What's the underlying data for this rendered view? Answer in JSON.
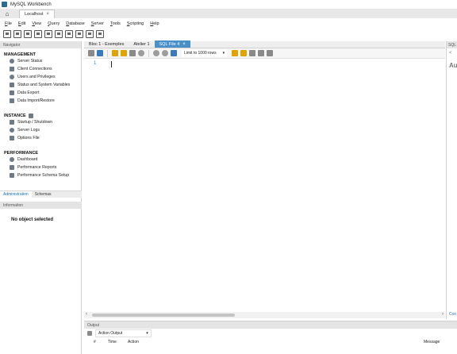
{
  "window": {
    "title": "MySQL Workbench"
  },
  "connection_tab": {
    "label": "Localhost",
    "close": "×"
  },
  "menu": [
    {
      "label": "File",
      "u": "F",
      "rest": "ile"
    },
    {
      "label": "Edit",
      "u": "E",
      "rest": "dit"
    },
    {
      "label": "View",
      "u": "V",
      "rest": "iew"
    },
    {
      "label": "Query",
      "u": "Q",
      "rest": "uery"
    },
    {
      "label": "Database",
      "u": "D",
      "rest": "atabase"
    },
    {
      "label": "Server",
      "u": "S",
      "rest": "erver"
    },
    {
      "label": "Tools",
      "u": "T",
      "rest": "ools"
    },
    {
      "label": "Scripting",
      "u": "S",
      "rest": "cripting"
    },
    {
      "label": "Help",
      "u": "H",
      "rest": "elp"
    }
  ],
  "navigator": {
    "header": "Navigator",
    "management": {
      "title": "MANAGEMENT",
      "items": [
        "Server Status",
        "Client Connections",
        "Users and Privileges",
        "Status and System Variables",
        "Data Export",
        "Data Import/Restore"
      ]
    },
    "instance": {
      "title": "INSTANCE",
      "items": [
        "Startup / Shutdown",
        "Server Logs",
        "Options File"
      ]
    },
    "performance": {
      "title": "PERFORMANCE",
      "items": [
        "Dashboard",
        "Performance Reports",
        "Performance Schema Setup"
      ]
    },
    "tabs": [
      "Administration",
      "Schemas"
    ],
    "information_header": "Information",
    "no_object": "No object selected"
  },
  "editor": {
    "tabs": [
      {
        "label": "Bloc 1 - Exemples",
        "active": false
      },
      {
        "label": "Atelier 1",
        "active": false
      },
      {
        "label": "SQL File 4",
        "active": true,
        "close": "×"
      }
    ],
    "limit_rows": "Limit to 1000 rows",
    "line_number": "1"
  },
  "right_panel": {
    "header": "SQL",
    "nav": "<",
    "big": "Au",
    "bottom": "Con"
  },
  "output": {
    "header": "Output",
    "dropdown": "Action Output",
    "columns": [
      "#",
      "Time",
      "Action",
      "Message"
    ]
  }
}
